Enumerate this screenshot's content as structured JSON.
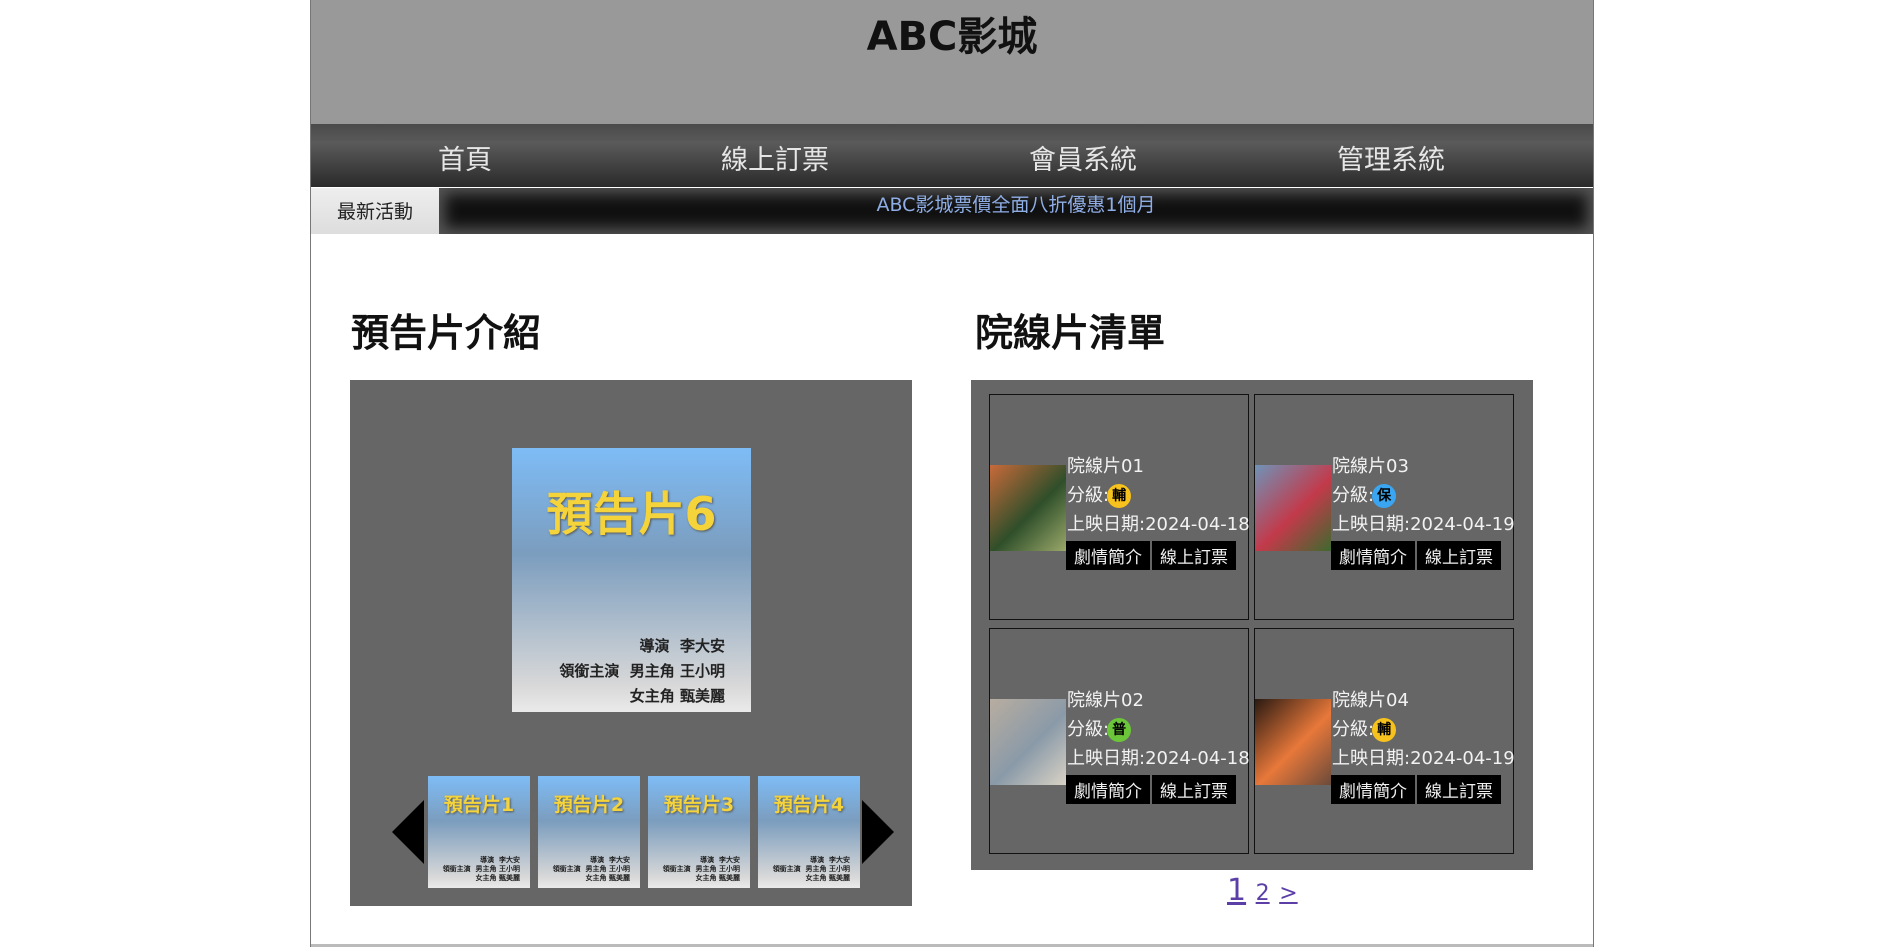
{
  "site": {
    "title": "ABC影城"
  },
  "nav": [
    "首頁",
    "線上訂票",
    "會員系統",
    "管理系統"
  ],
  "news": {
    "label": "最新活動",
    "text": "ABC影城票價全面八折優惠1個月"
  },
  "trailers": {
    "heading": "預告片介紹",
    "featured": {
      "title": "預告片6",
      "credit": "導演  李大安\n領銜主演  男主角 王小明\n女主角 甄美麗"
    },
    "thumbs": [
      {
        "title": "預告片1",
        "credit": "導演  李大安\n領銜主演  男主角 王小明\n女主角 甄美麗"
      },
      {
        "title": "預告片2",
        "credit": "導演  李大安\n領銜主演  男主角 王小明\n女主角 甄美麗"
      },
      {
        "title": "預告片3",
        "credit": "導演  李大安\n領銜主演  男主角 王小明\n女主角 甄美麗"
      },
      {
        "title": "預告片4",
        "credit": "導演  李大安\n領銜主演  男主角 王小明\n女主角 甄美麗"
      }
    ]
  },
  "movies": {
    "heading": "院線片清單",
    "items": [
      {
        "name": "院線片01",
        "rating_label": "分級:",
        "rating": "輔",
        "rating_color": "#f7c21d",
        "date": "上映日期:2024-04-18",
        "btn_intro": "劇情簡介",
        "btn_book": "線上訂票",
        "photo_colors": [
          "#c86a3a",
          "#2f4f2a",
          "#9aa86a"
        ]
      },
      {
        "name": "院線片03",
        "rating_label": "分級:",
        "rating": "保",
        "rating_color": "#3aa5f0",
        "date": "上映日期:2024-04-19",
        "btn_intro": "劇情簡介",
        "btn_book": "線上訂票",
        "photo_colors": [
          "#6f93b8",
          "#c23a4a",
          "#3e6a2e"
        ]
      },
      {
        "name": "院線片02",
        "rating_label": "分級:",
        "rating": "普",
        "rating_color": "#6cc63a",
        "date": "上映日期:2024-04-18",
        "btn_intro": "劇情簡介",
        "btn_book": "線上訂票",
        "photo_colors": [
          "#b8ada0",
          "#8a9aa8",
          "#d9d2c5"
        ]
      },
      {
        "name": "院線片04",
        "rating_label": "分級:",
        "rating": "輔",
        "rating_color": "#f7c21d",
        "date": "上映日期:2024-04-19",
        "btn_intro": "劇情簡介",
        "btn_book": "線上訂票",
        "photo_colors": [
          "#2a1a12",
          "#e8783a",
          "#6a4a3a"
        ]
      }
    ],
    "pager": {
      "current": "1",
      "next_page": "2",
      "next_arrow": ">"
    }
  }
}
